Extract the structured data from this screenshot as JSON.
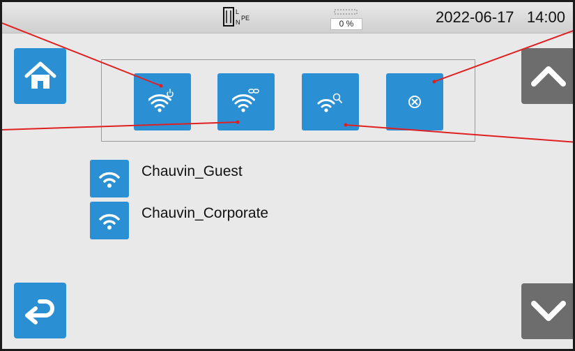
{
  "statusbar": {
    "mains_label": "PE",
    "battery_percent": "0 %",
    "date": "2022-06-17",
    "time": "14:00"
  },
  "networks": [
    {
      "name": "Chauvin_Guest"
    },
    {
      "name": "Chauvin_Corporate"
    }
  ],
  "icons": {
    "home": "home-icon",
    "back": "return-arrow-icon",
    "up": "chevron-up-icon",
    "down": "chevron-down-icon",
    "wifi_on_off": "wifi-power-icon",
    "wifi_connect": "wifi-link-icon",
    "wifi_search": "wifi-search-icon",
    "cancel": "cancel-circle-icon"
  },
  "colors": {
    "accent": "#2b8fd3",
    "nav_gray": "#6d6d6d",
    "callout": "#e02020"
  }
}
